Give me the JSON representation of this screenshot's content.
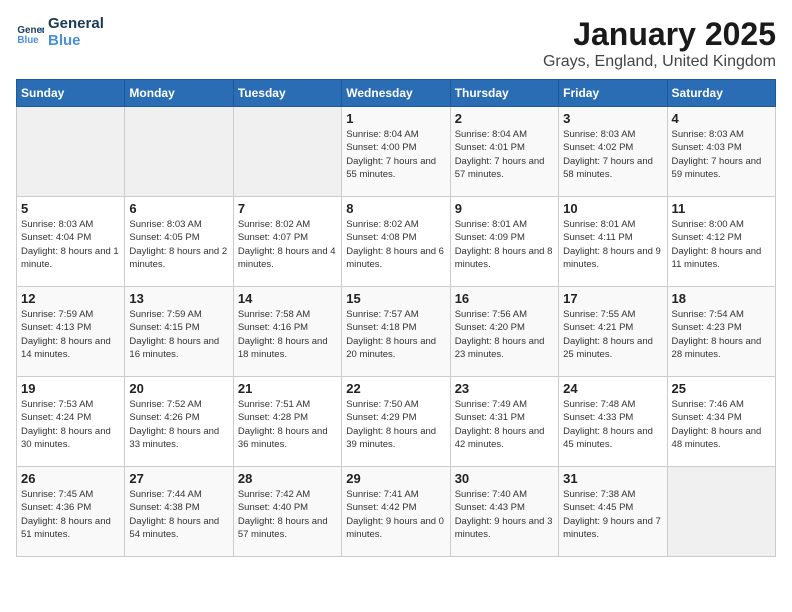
{
  "app": {
    "logo_line1": "General",
    "logo_line2": "Blue"
  },
  "header": {
    "title": "January 2025",
    "subtitle": "Grays, England, United Kingdom"
  },
  "days_of_week": [
    "Sunday",
    "Monday",
    "Tuesday",
    "Wednesday",
    "Thursday",
    "Friday",
    "Saturday"
  ],
  "weeks": [
    [
      {
        "day": "",
        "sunrise": "",
        "sunset": "",
        "daylight": ""
      },
      {
        "day": "",
        "sunrise": "",
        "sunset": "",
        "daylight": ""
      },
      {
        "day": "",
        "sunrise": "",
        "sunset": "",
        "daylight": ""
      },
      {
        "day": "1",
        "sunrise": "Sunrise: 8:04 AM",
        "sunset": "Sunset: 4:00 PM",
        "daylight": "Daylight: 7 hours and 55 minutes."
      },
      {
        "day": "2",
        "sunrise": "Sunrise: 8:04 AM",
        "sunset": "Sunset: 4:01 PM",
        "daylight": "Daylight: 7 hours and 57 minutes."
      },
      {
        "day": "3",
        "sunrise": "Sunrise: 8:03 AM",
        "sunset": "Sunset: 4:02 PM",
        "daylight": "Daylight: 7 hours and 58 minutes."
      },
      {
        "day": "4",
        "sunrise": "Sunrise: 8:03 AM",
        "sunset": "Sunset: 4:03 PM",
        "daylight": "Daylight: 7 hours and 59 minutes."
      }
    ],
    [
      {
        "day": "5",
        "sunrise": "Sunrise: 8:03 AM",
        "sunset": "Sunset: 4:04 PM",
        "daylight": "Daylight: 8 hours and 1 minute."
      },
      {
        "day": "6",
        "sunrise": "Sunrise: 8:03 AM",
        "sunset": "Sunset: 4:05 PM",
        "daylight": "Daylight: 8 hours and 2 minutes."
      },
      {
        "day": "7",
        "sunrise": "Sunrise: 8:02 AM",
        "sunset": "Sunset: 4:07 PM",
        "daylight": "Daylight: 8 hours and 4 minutes."
      },
      {
        "day": "8",
        "sunrise": "Sunrise: 8:02 AM",
        "sunset": "Sunset: 4:08 PM",
        "daylight": "Daylight: 8 hours and 6 minutes."
      },
      {
        "day": "9",
        "sunrise": "Sunrise: 8:01 AM",
        "sunset": "Sunset: 4:09 PM",
        "daylight": "Daylight: 8 hours and 8 minutes."
      },
      {
        "day": "10",
        "sunrise": "Sunrise: 8:01 AM",
        "sunset": "Sunset: 4:11 PM",
        "daylight": "Daylight: 8 hours and 9 minutes."
      },
      {
        "day": "11",
        "sunrise": "Sunrise: 8:00 AM",
        "sunset": "Sunset: 4:12 PM",
        "daylight": "Daylight: 8 hours and 11 minutes."
      }
    ],
    [
      {
        "day": "12",
        "sunrise": "Sunrise: 7:59 AM",
        "sunset": "Sunset: 4:13 PM",
        "daylight": "Daylight: 8 hours and 14 minutes."
      },
      {
        "day": "13",
        "sunrise": "Sunrise: 7:59 AM",
        "sunset": "Sunset: 4:15 PM",
        "daylight": "Daylight: 8 hours and 16 minutes."
      },
      {
        "day": "14",
        "sunrise": "Sunrise: 7:58 AM",
        "sunset": "Sunset: 4:16 PM",
        "daylight": "Daylight: 8 hours and 18 minutes."
      },
      {
        "day": "15",
        "sunrise": "Sunrise: 7:57 AM",
        "sunset": "Sunset: 4:18 PM",
        "daylight": "Daylight: 8 hours and 20 minutes."
      },
      {
        "day": "16",
        "sunrise": "Sunrise: 7:56 AM",
        "sunset": "Sunset: 4:20 PM",
        "daylight": "Daylight: 8 hours and 23 minutes."
      },
      {
        "day": "17",
        "sunrise": "Sunrise: 7:55 AM",
        "sunset": "Sunset: 4:21 PM",
        "daylight": "Daylight: 8 hours and 25 minutes."
      },
      {
        "day": "18",
        "sunrise": "Sunrise: 7:54 AM",
        "sunset": "Sunset: 4:23 PM",
        "daylight": "Daylight: 8 hours and 28 minutes."
      }
    ],
    [
      {
        "day": "19",
        "sunrise": "Sunrise: 7:53 AM",
        "sunset": "Sunset: 4:24 PM",
        "daylight": "Daylight: 8 hours and 30 minutes."
      },
      {
        "day": "20",
        "sunrise": "Sunrise: 7:52 AM",
        "sunset": "Sunset: 4:26 PM",
        "daylight": "Daylight: 8 hours and 33 minutes."
      },
      {
        "day": "21",
        "sunrise": "Sunrise: 7:51 AM",
        "sunset": "Sunset: 4:28 PM",
        "daylight": "Daylight: 8 hours and 36 minutes."
      },
      {
        "day": "22",
        "sunrise": "Sunrise: 7:50 AM",
        "sunset": "Sunset: 4:29 PM",
        "daylight": "Daylight: 8 hours and 39 minutes."
      },
      {
        "day": "23",
        "sunrise": "Sunrise: 7:49 AM",
        "sunset": "Sunset: 4:31 PM",
        "daylight": "Daylight: 8 hours and 42 minutes."
      },
      {
        "day": "24",
        "sunrise": "Sunrise: 7:48 AM",
        "sunset": "Sunset: 4:33 PM",
        "daylight": "Daylight: 8 hours and 45 minutes."
      },
      {
        "day": "25",
        "sunrise": "Sunrise: 7:46 AM",
        "sunset": "Sunset: 4:34 PM",
        "daylight": "Daylight: 8 hours and 48 minutes."
      }
    ],
    [
      {
        "day": "26",
        "sunrise": "Sunrise: 7:45 AM",
        "sunset": "Sunset: 4:36 PM",
        "daylight": "Daylight: 8 hours and 51 minutes."
      },
      {
        "day": "27",
        "sunrise": "Sunrise: 7:44 AM",
        "sunset": "Sunset: 4:38 PM",
        "daylight": "Daylight: 8 hours and 54 minutes."
      },
      {
        "day": "28",
        "sunrise": "Sunrise: 7:42 AM",
        "sunset": "Sunset: 4:40 PM",
        "daylight": "Daylight: 8 hours and 57 minutes."
      },
      {
        "day": "29",
        "sunrise": "Sunrise: 7:41 AM",
        "sunset": "Sunset: 4:42 PM",
        "daylight": "Daylight: 9 hours and 0 minutes."
      },
      {
        "day": "30",
        "sunrise": "Sunrise: 7:40 AM",
        "sunset": "Sunset: 4:43 PM",
        "daylight": "Daylight: 9 hours and 3 minutes."
      },
      {
        "day": "31",
        "sunrise": "Sunrise: 7:38 AM",
        "sunset": "Sunset: 4:45 PM",
        "daylight": "Daylight: 9 hours and 7 minutes."
      },
      {
        "day": "",
        "sunrise": "",
        "sunset": "",
        "daylight": ""
      }
    ]
  ]
}
